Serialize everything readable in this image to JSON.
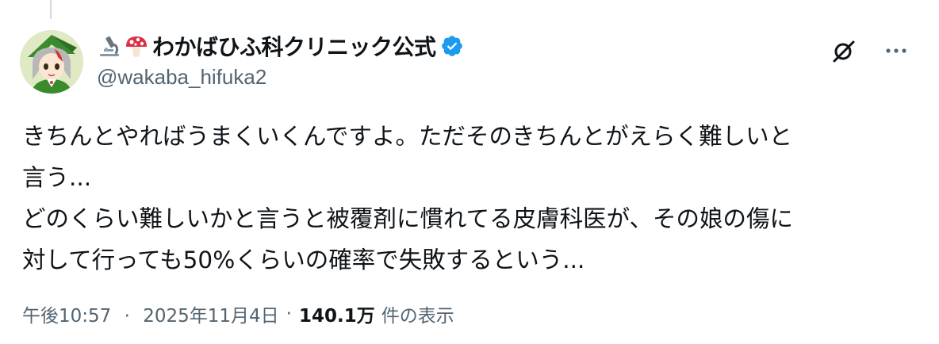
{
  "thread": {
    "has_parent_line": true
  },
  "author": {
    "display_name": "わかばひふ科クリニック公式",
    "handle": "@wakaba_hifuka2",
    "verified": true,
    "emojis": [
      "microscope-icon",
      "mushroom-icon"
    ]
  },
  "actions": {
    "grok_icon": "grok-icon",
    "more_icon": "more-icon"
  },
  "tweet": {
    "lines": [
      "きちんとやればうまくいくんですよ。ただそのきちんとがえらく難しいと",
      "言う...",
      "どのくらい難しいかと言うと被覆剤に慣れてる皮膚科医が、その娘の傷に",
      "対して行っても50%くらいの確率で失敗するという..."
    ]
  },
  "meta": {
    "time": "午後10:57",
    "separator": "·",
    "date": "2025年11月4日",
    "views_count": "140.1万",
    "views_label": "件の表示"
  },
  "colors": {
    "text": "#0f1419",
    "secondary": "#536471",
    "verified": "#1d9bf0",
    "thread_line": "#cfd9de"
  }
}
